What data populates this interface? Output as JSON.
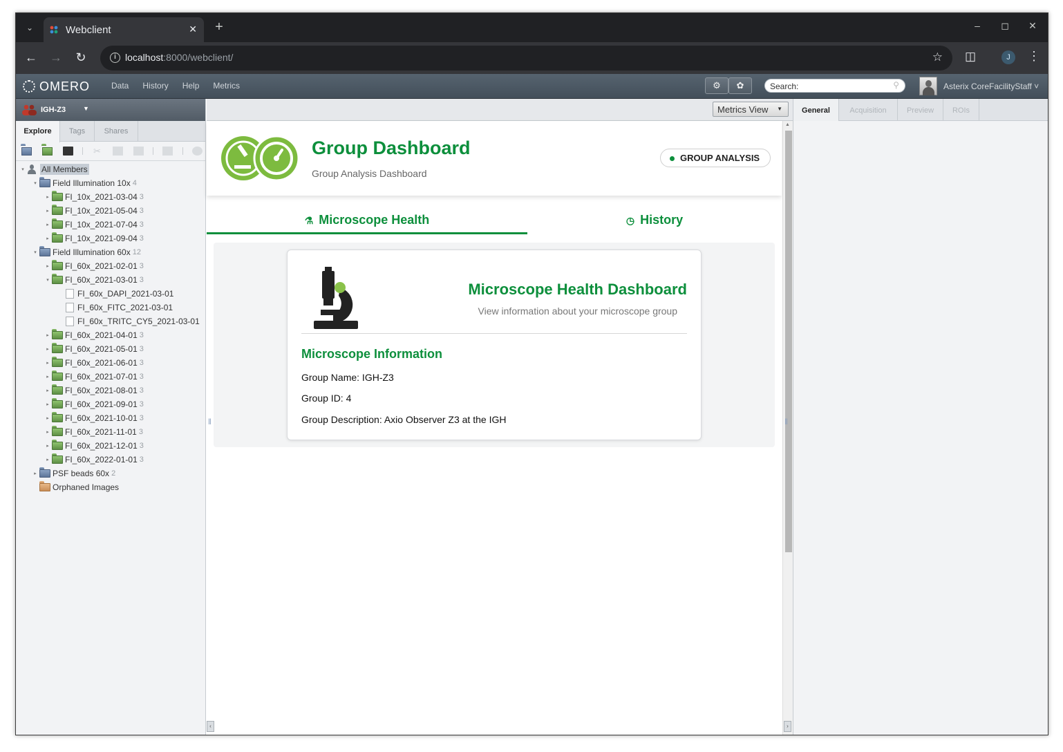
{
  "browser": {
    "tab_title": "Webclient",
    "url_host": "localhost",
    "url_rest": ":8000/webclient/",
    "profile_initial": "J"
  },
  "omero": {
    "logo_text": "OMERO",
    "nav": [
      "Data",
      "History",
      "Help",
      "Metrics"
    ],
    "search_label": "Search:",
    "user_name": "Asterix CoreFacilityStaff"
  },
  "left": {
    "group_name": "IGH-Z3",
    "tabs": [
      "Explore",
      "Tags",
      "Shares"
    ],
    "tree": {
      "root": "All Members",
      "projects": [
        {
          "name": "Field Illumination 10x",
          "count": "4",
          "datasets": [
            {
              "name": "FI_10x_2021-03-04",
              "count": "3"
            },
            {
              "name": "FI_10x_2021-05-04",
              "count": "3"
            },
            {
              "name": "FI_10x_2021-07-04",
              "count": "3"
            },
            {
              "name": "FI_10x_2021-09-04",
              "count": "3"
            }
          ]
        },
        {
          "name": "Field Illumination 60x",
          "count": "12",
          "datasets": [
            {
              "name": "FI_60x_2021-02-01",
              "count": "3"
            },
            {
              "name": "FI_60x_2021-03-01",
              "count": "3",
              "images": [
                "FI_60x_DAPI_2021-03-01",
                "FI_60x_FITC_2021-03-01",
                "FI_60x_TRITC_CY5_2021-03-01"
              ]
            },
            {
              "name": "FI_60x_2021-04-01",
              "count": "3"
            },
            {
              "name": "FI_60x_2021-05-01",
              "count": "3"
            },
            {
              "name": "FI_60x_2021-06-01",
              "count": "3"
            },
            {
              "name": "FI_60x_2021-07-01",
              "count": "3"
            },
            {
              "name": "FI_60x_2021-08-01",
              "count": "3"
            },
            {
              "name": "FI_60x_2021-09-01",
              "count": "3"
            },
            {
              "name": "FI_60x_2021-10-01",
              "count": "3"
            },
            {
              "name": "FI_60x_2021-11-01",
              "count": "3"
            },
            {
              "name": "FI_60x_2021-12-01",
              "count": "3"
            },
            {
              "name": "FI_60x_2022-01-01",
              "count": "3"
            }
          ]
        },
        {
          "name": "PSF beads 60x",
          "count": "2",
          "datasets": []
        }
      ],
      "orphaned": "Orphaned Images"
    }
  },
  "center": {
    "view_selector": "Metrics View",
    "dashboard_title": "Group Dashboard",
    "dashboard_subtitle": "Group Analysis Dashboard",
    "badge": "GROUP ANALYSIS",
    "tabs": [
      "Microscope Health",
      "History"
    ],
    "card": {
      "title": "Microscope Health Dashboard",
      "subtitle": "View information about your microscope group",
      "section_title": "Microscope Information",
      "lines": [
        "Group Name: IGH-Z3",
        "Group ID: 4",
        "Group Description: Axio Observer Z3 at the IGH"
      ]
    }
  },
  "right": {
    "tabs": [
      "General",
      "Acquisition",
      "Preview",
      "ROIs"
    ]
  },
  "colors": {
    "accent_green": "#0d8f3c",
    "header_bg": "#4b5762"
  }
}
